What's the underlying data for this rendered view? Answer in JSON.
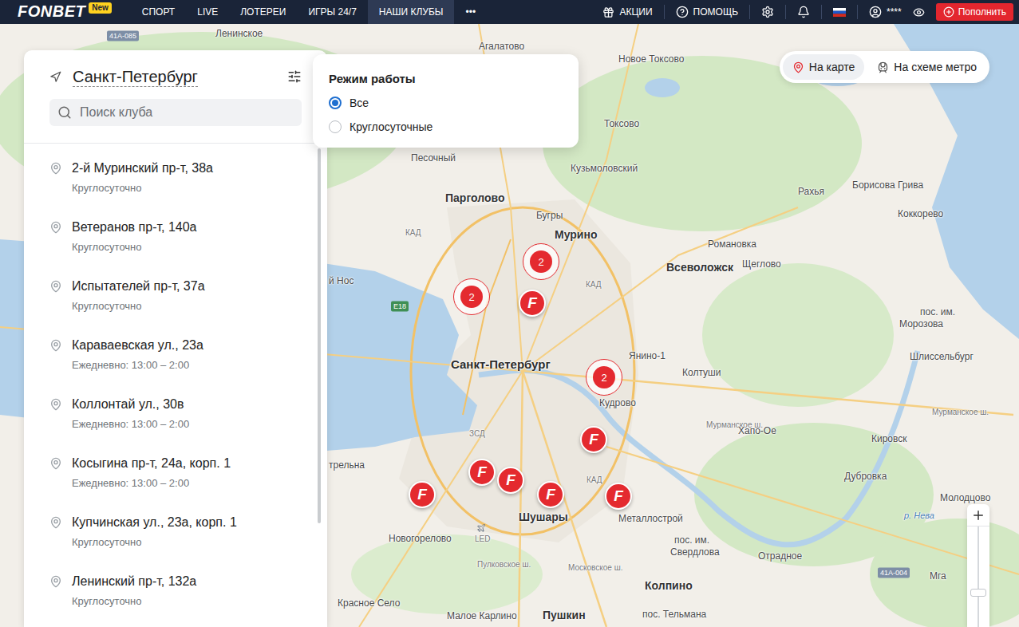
{
  "nav": {
    "logo": "FONBET",
    "logo_badge": "New",
    "items": [
      {
        "label": "СПОРТ",
        "selected": false
      },
      {
        "label": "LIVE",
        "selected": false
      },
      {
        "label": "ЛОТЕРЕИ",
        "selected": false
      },
      {
        "label": "ИГРЫ 24/7",
        "selected": false
      },
      {
        "label": "НАШИ КЛУБЫ",
        "selected": true
      },
      {
        "label": "•••",
        "selected": false
      }
    ],
    "promo": "АКЦИИ",
    "help": "ПОМОЩЬ",
    "user": "****",
    "deposit": "Пополнить"
  },
  "view_toggle": [
    {
      "label": "На карте",
      "selected": true
    },
    {
      "label": "На схеме метро",
      "selected": false
    }
  ],
  "sidebar": {
    "city": "Санкт-Петербург",
    "search": {
      "placeholder": "Поиск клуба"
    },
    "clubs": [
      {
        "address": "2-й Муринский пр-т, 38а",
        "hours": "Круглосуточно"
      },
      {
        "address": "Ветеранов пр-т, 140а",
        "hours": "Круглосуточно"
      },
      {
        "address": "Испытателей пр-т, 37а",
        "hours": "Круглосуточно"
      },
      {
        "address": "Караваевская ул., 23а",
        "hours": "Ежедневно: 13:00 – 2:00"
      },
      {
        "address": "Коллонтай ул., 30в",
        "hours": "Ежедневно: 13:00 – 2:00"
      },
      {
        "address": "Косыгина пр-т, 24а, корп. 1",
        "hours": "Ежедневно: 13:00 – 2:00"
      },
      {
        "address": "Купчинская ул., 23а, корп. 1",
        "hours": "Круглосуточно"
      },
      {
        "address": "Ленинский пр-т, 132а",
        "hours": "Круглосуточно"
      }
    ]
  },
  "filter": {
    "title": "Режим работы",
    "options": [
      {
        "label": "Все",
        "selected": true
      },
      {
        "label": "Круглосуточные",
        "selected": false
      }
    ]
  },
  "map": {
    "labels": [
      {
        "text": "41А-085",
        "kind": "badge"
      },
      {
        "text": "Ленинское",
        "kind": "town"
      },
      {
        "text": "Агалатово",
        "kind": "town"
      },
      {
        "text": "Новое Токсово",
        "kind": "town"
      },
      {
        "text": "Токсово",
        "kind": "town"
      },
      {
        "text": "Песочный",
        "kind": "town"
      },
      {
        "text": "Кузьмоловский",
        "kind": "town"
      },
      {
        "text": "Рахья",
        "kind": "town"
      },
      {
        "text": "Борисова Грива",
        "kind": "town"
      },
      {
        "text": "Коккорево",
        "kind": "town"
      },
      {
        "text": "Парголово",
        "kind": "city"
      },
      {
        "text": "Бугры",
        "kind": "town"
      },
      {
        "text": "Мурино",
        "kind": "city"
      },
      {
        "text": "КАД",
        "kind": "road"
      },
      {
        "text": "Романовка",
        "kind": "town"
      },
      {
        "text": "Всеволожск",
        "kind": "city"
      },
      {
        "text": "Щеглово",
        "kind": "town"
      },
      {
        "text": "й Нос",
        "kind": "town"
      },
      {
        "text": "КАД",
        "kind": "road"
      },
      {
        "text": "E18",
        "kind": "badge-green"
      },
      {
        "text": "пос. им.",
        "kind": "town"
      },
      {
        "text": "Морозова",
        "kind": "town"
      },
      {
        "text": "Санкт-Петербург",
        "kind": "bigcity"
      },
      {
        "text": "Янино-1",
        "kind": "town"
      },
      {
        "text": "Колтуши",
        "kind": "town"
      },
      {
        "text": "Шлиссельбург",
        "kind": "town"
      },
      {
        "text": "Кудрово",
        "kind": "town"
      },
      {
        "text": "Мурманское ш.",
        "kind": "road"
      },
      {
        "text": "Мурманское ш.",
        "kind": "road"
      },
      {
        "text": "ЗСД",
        "kind": "road"
      },
      {
        "text": "Хапо-Ое",
        "kind": "town"
      },
      {
        "text": "Кировск",
        "kind": "town"
      },
      {
        "text": "трельна",
        "kind": "town"
      },
      {
        "text": "Дубровка",
        "kind": "town"
      },
      {
        "text": "Молодцово",
        "kind": "town"
      },
      {
        "text": "КАД",
        "kind": "road"
      },
      {
        "text": "Шушары",
        "kind": "city"
      },
      {
        "text": "Металлострой",
        "kind": "town"
      },
      {
        "text": "р. Нева",
        "kind": "water"
      },
      {
        "text": "Новогорелово",
        "kind": "town"
      },
      {
        "text": "LED",
        "kind": "road"
      },
      {
        "text": "пос. им.",
        "kind": "town"
      },
      {
        "text": "Свердлова",
        "kind": "town"
      },
      {
        "text": "Отрадное",
        "kind": "town"
      },
      {
        "text": "41А-004",
        "kind": "badge"
      },
      {
        "text": "Мга",
        "kind": "town"
      },
      {
        "text": "Пулковское ш.",
        "kind": "road"
      },
      {
        "text": "Московское ш.",
        "kind": "road"
      },
      {
        "text": "Колпино",
        "kind": "city"
      },
      {
        "text": "Красное Село",
        "kind": "town"
      },
      {
        "text": "Пушкин",
        "kind": "city"
      },
      {
        "text": "пос. Тельмана",
        "kind": "town"
      },
      {
        "text": "Малое Карлино",
        "kind": "town"
      }
    ],
    "markers": [
      {
        "kind": "cluster",
        "text": "2"
      },
      {
        "kind": "cluster",
        "text": "2"
      },
      {
        "kind": "cluster",
        "text": "2"
      },
      {
        "kind": "club",
        "text": "F"
      },
      {
        "kind": "club",
        "text": "F"
      },
      {
        "kind": "club",
        "text": "F"
      },
      {
        "kind": "club",
        "text": "F"
      },
      {
        "kind": "club",
        "text": "F"
      },
      {
        "kind": "club",
        "text": "F"
      },
      {
        "kind": "club",
        "text": "F"
      }
    ]
  },
  "zoom": {
    "level": 0.38
  }
}
